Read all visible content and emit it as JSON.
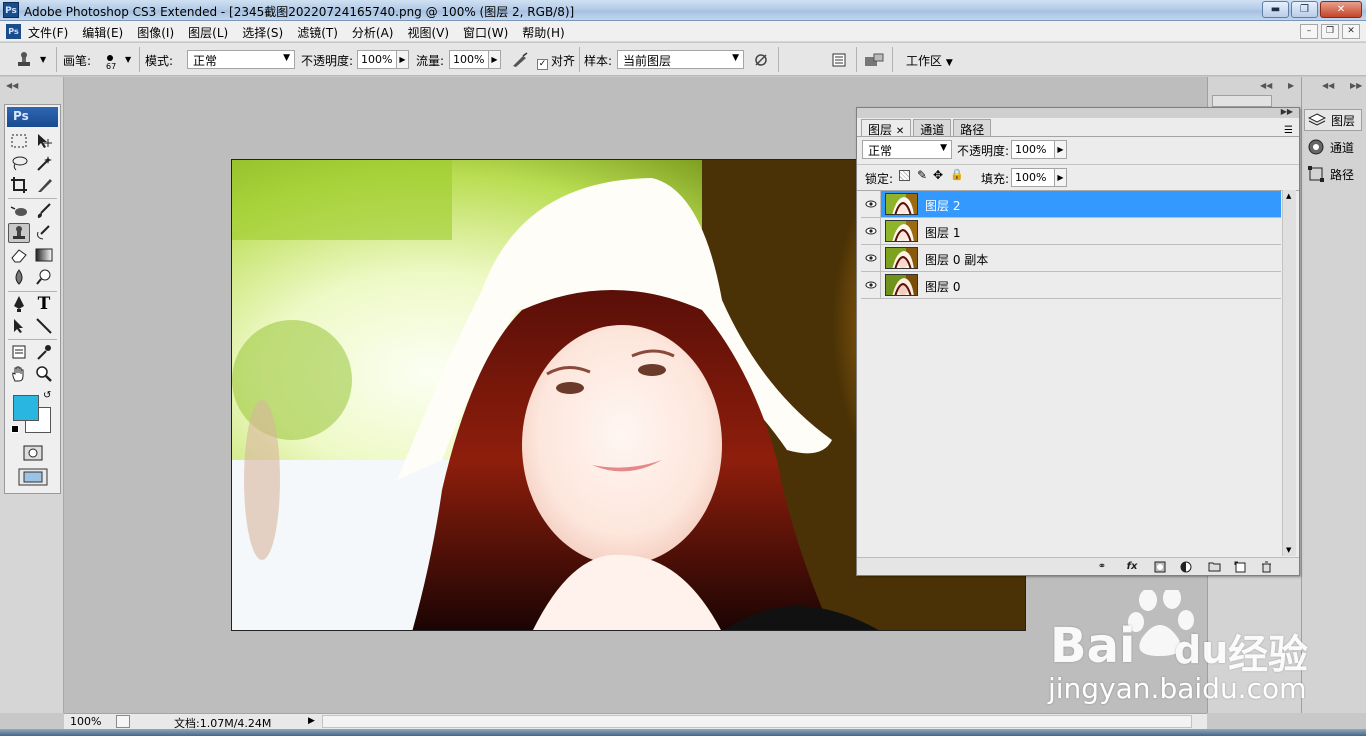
{
  "window": {
    "title": "Adobe Photoshop CS3 Extended - [2345截图20220724165740.png @ 100% (图层 2, RGB/8)]",
    "logo": "Ps",
    "buttons": [
      "minimize",
      "maximize",
      "close"
    ]
  },
  "menu": {
    "items": [
      "文件(F)",
      "编辑(E)",
      "图像(I)",
      "图层(L)",
      "选择(S)",
      "滤镜(T)",
      "分析(A)",
      "视图(V)",
      "窗口(W)",
      "帮助(H)"
    ]
  },
  "options": {
    "brush_label": "画笔:",
    "brush_size": "67",
    "mode_label": "模式:",
    "mode_value": "正常",
    "opacity_label": "不透明度:",
    "opacity_value": "100%",
    "flow_label": "流量:",
    "flow_value": "100%",
    "aligned_label": "对齐",
    "aligned_checked": true,
    "sample_label": "样本:",
    "sample_value": "当前图层",
    "workspace_label": "工作区"
  },
  "tools": {
    "logo": "Ps",
    "foreground_color": "#29b6e0",
    "background_color": "#ffffff",
    "active_tool": "clone-stamp"
  },
  "layers_panel": {
    "tabs": [
      "图层",
      "通道",
      "路径"
    ],
    "active_tab": "图层",
    "blend_mode": "正常",
    "opacity_label": "不透明度:",
    "opacity_value": "100%",
    "lock_label": "锁定:",
    "fill_label": "填充:",
    "fill_value": "100%",
    "layers": [
      {
        "name": "图层 2",
        "selected": true,
        "visible": true
      },
      {
        "name": "图层 1",
        "selected": false,
        "visible": true
      },
      {
        "name": "图层 0 副本",
        "selected": false,
        "visible": true
      },
      {
        "name": "图层 0",
        "selected": false,
        "visible": true
      }
    ]
  },
  "dock": {
    "items": [
      "图层",
      "通道",
      "路径"
    ],
    "active": "图层"
  },
  "status": {
    "zoom": "100%",
    "doc_info": "文档:1.07M/4.24M"
  },
  "watermark": {
    "brand": "Bai",
    "brand2": "du",
    "brand_cn": "经验",
    "url": "jingyan.baidu.com"
  }
}
